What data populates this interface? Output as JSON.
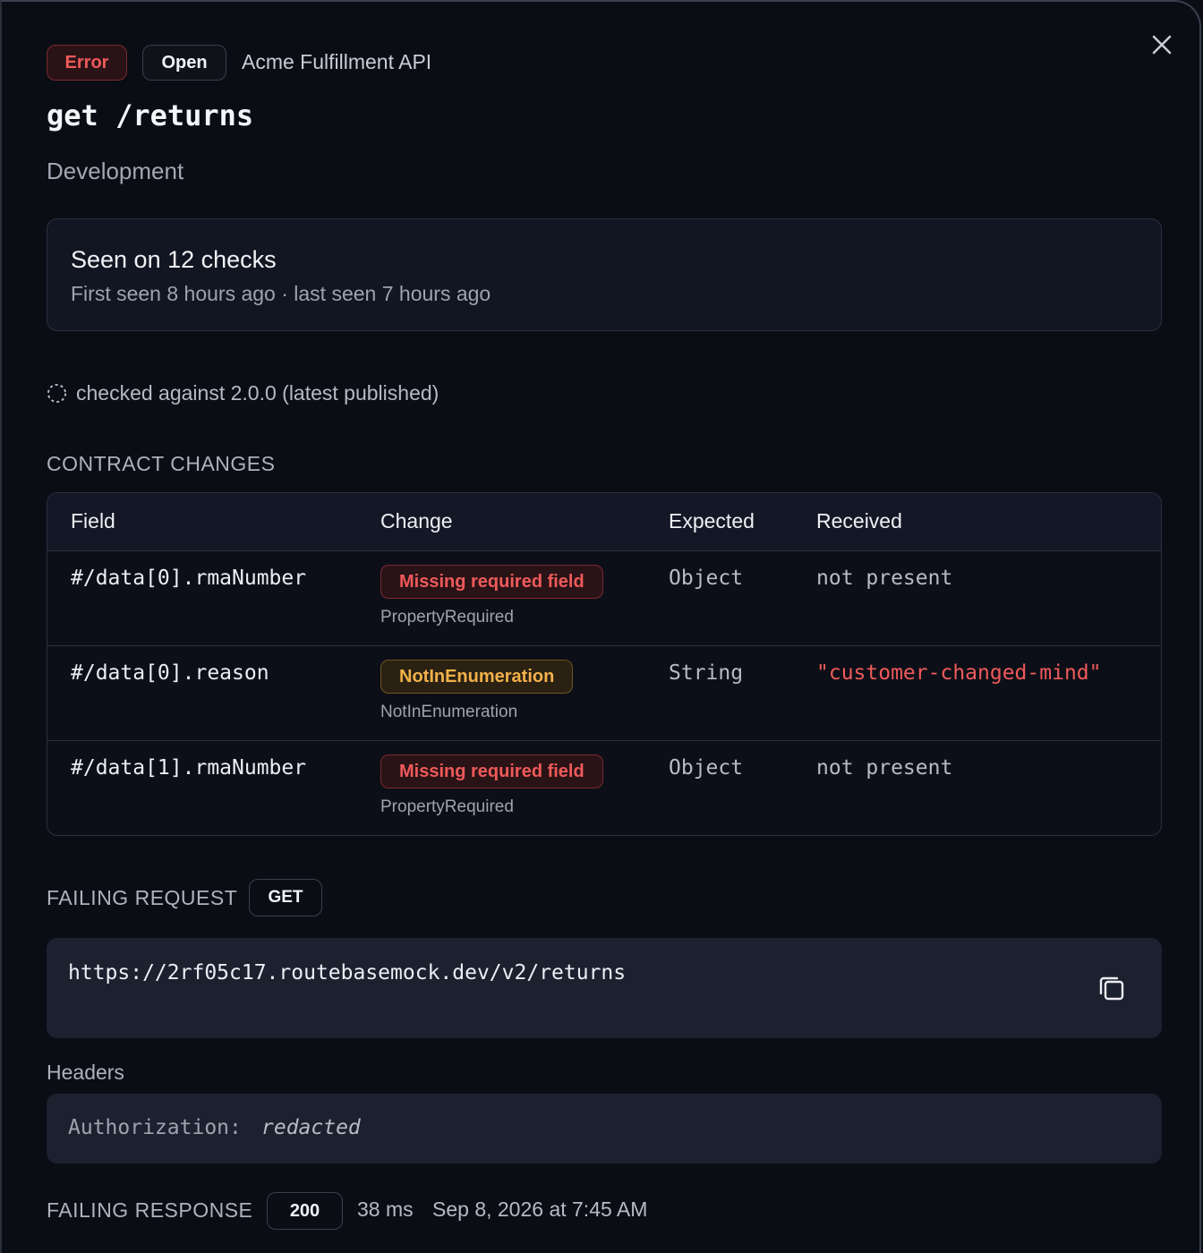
{
  "header": {
    "status_badge": "Error",
    "state_badge": "Open",
    "api_name": "Acme Fulfillment API",
    "title": "get /returns",
    "environment": "Development"
  },
  "seen": {
    "title": "Seen on 12 checks",
    "subtitle": "First seen 8 hours ago · last seen 7 hours ago"
  },
  "checked_against": "checked against 2.0.0 (latest published)",
  "contract_changes": {
    "label": "CONTRACT CHANGES",
    "columns": [
      "Field",
      "Change",
      "Expected",
      "Received"
    ],
    "rows": [
      {
        "field": "#/data[0].rmaNumber",
        "change": "Missing required field",
        "change_kind": "PropertyRequired",
        "severity": "error",
        "expected": "Object",
        "received": "not present"
      },
      {
        "field": "#/data[0].reason",
        "change": "NotInEnumeration",
        "change_kind": "NotInEnumeration",
        "severity": "warning",
        "expected": "String",
        "received": "\"customer-changed-mind\""
      },
      {
        "field": "#/data[1].rmaNumber",
        "change": "Missing required field",
        "change_kind": "PropertyRequired",
        "severity": "error",
        "expected": "Object",
        "received": "not present"
      }
    ]
  },
  "failing_request": {
    "label": "FAILING REQUEST",
    "method": "GET",
    "url": "https://2rf05c17.routebasemock.dev/v2/returns",
    "headers_label": "Headers",
    "header_key": "Authorization:",
    "header_value": "redacted"
  },
  "failing_response": {
    "label": "FAILING RESPONSE",
    "status": "200",
    "duration": "38 ms",
    "timestamp": "Sep 8, 2026 at 7:45 AM"
  },
  "colors": {
    "background": "#0b0d15",
    "error": "#ef5a5a",
    "warning": "#f2b14b",
    "card": "#121623",
    "code_box": "#1c2130"
  }
}
